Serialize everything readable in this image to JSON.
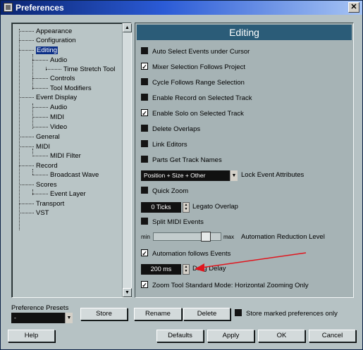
{
  "window": {
    "title": "Preferences",
    "close_glyph": "✕"
  },
  "tree": {
    "items": [
      {
        "label": "Appearance"
      },
      {
        "label": "Configuration"
      },
      {
        "label": "Editing"
      },
      {
        "label": "Audio"
      },
      {
        "label": "Time Stretch Tool"
      },
      {
        "label": "Controls"
      },
      {
        "label": "Tool Modifiers"
      },
      {
        "label": "Event Display"
      },
      {
        "label": "Audio"
      },
      {
        "label": "MIDI"
      },
      {
        "label": "Video"
      },
      {
        "label": "General"
      },
      {
        "label": "MIDI"
      },
      {
        "label": "MIDI Filter"
      },
      {
        "label": "Record"
      },
      {
        "label": "Broadcast Wave"
      },
      {
        "label": "Scores"
      },
      {
        "label": "Event Layer"
      },
      {
        "label": "Transport"
      },
      {
        "label": "VST"
      }
    ],
    "selected": "Editing",
    "scroll_up": "▲",
    "scroll_down": "▼"
  },
  "editing": {
    "header": "Editing",
    "options": [
      {
        "label": "Auto Select Events under Cursor",
        "checked": false
      },
      {
        "label": "Mixer Selection Follows Project",
        "checked": true
      },
      {
        "label": "Cycle Follows Range Selection",
        "checked": false
      },
      {
        "label": "Enable Record on Selected Track",
        "checked": false
      },
      {
        "label": "Enable Solo on Selected Track",
        "checked": true
      },
      {
        "label": "Delete Overlaps",
        "checked": false
      },
      {
        "label": "Link Editors",
        "checked": false
      },
      {
        "label": "Parts Get Track Names",
        "checked": false
      }
    ],
    "lock_event": {
      "value": "Position + Size + Other",
      "label": "Lock Event Attributes"
    },
    "quick_zoom": {
      "label": "Quick Zoom",
      "checked": false
    },
    "legato": {
      "value": "0 Ticks",
      "label": "Legato Overlap"
    },
    "split_midi": {
      "label": "Split MIDI Events",
      "checked": false
    },
    "automation": {
      "min_label": "min",
      "max_label": "max",
      "label": "Automation Reduction Level",
      "level": 0.82
    },
    "automation_follows": {
      "label": "Automation follows Events",
      "checked": true
    },
    "drag_delay": {
      "value": "200 ms",
      "label": "Drag Delay"
    },
    "zoom_tool": {
      "label": "Zoom Tool Standard Mode: Horizontal Zooming Only",
      "checked": true
    },
    "check_glyph": "✓",
    "arrow_color": "#e0161e"
  },
  "presets": {
    "label": "Preference Presets",
    "value": "-",
    "store": "Store",
    "rename": "Rename",
    "delete": "Delete",
    "store_marked": "Store marked preferences only",
    "store_marked_checked": false
  },
  "footer": {
    "help": "Help",
    "defaults": "Defaults",
    "apply": "Apply",
    "ok": "OK",
    "cancel": "Cancel"
  }
}
